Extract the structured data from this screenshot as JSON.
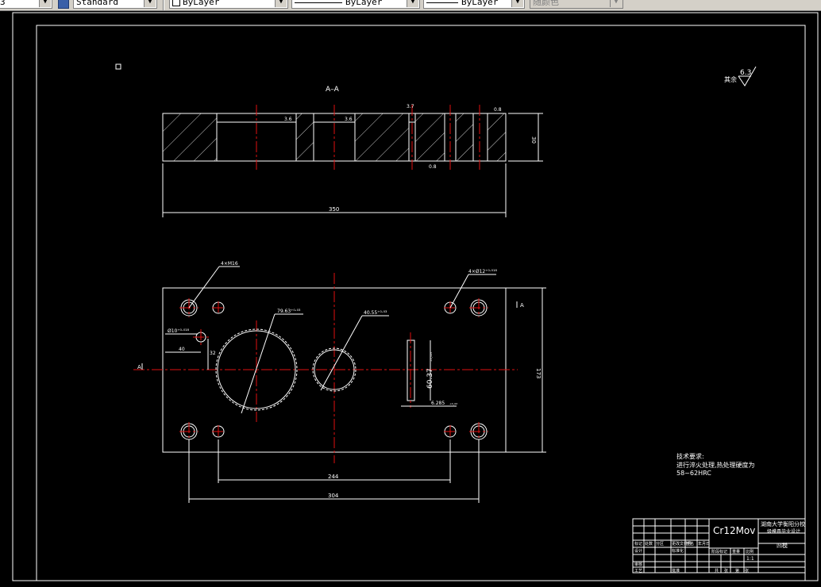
{
  "toolbar": {
    "left_stub": "3",
    "textstyle_value": "Standard",
    "layer_value": "ByLayer",
    "linetype_value": "ByLayer",
    "lineweight_value": "ByLayer",
    "color_value": "随颜色",
    "dropdown_arrow": "▼"
  },
  "drawing": {
    "section_label": "A–A",
    "roughness_prefix": "其余",
    "roughness_value": "6.3",
    "section_dims": {
      "total_width": "350",
      "height": "30",
      "label_1": "3.6",
      "label_2": "3.6",
      "label_3": "3.7",
      "label_4": "0.8",
      "label_5": "0.8"
    },
    "plan_dims": {
      "hole_4xm16": "4×M16",
      "hole_4xd12": "4×Ø12⁺⁰·⁰¹⁸",
      "dia_79": "79.63⁺⁰·⁰³",
      "dia_40": "40.55⁺⁰·⁰³",
      "dia_10": "Ø10⁺⁰·⁰¹⁸",
      "offset_40": "40",
      "offset_32": "32",
      "slot_length": "60.37",
      "slot_tol": "⁺⁰·⁰²⁵",
      "slot_width": "6.285",
      "slot_width_tol": "⁺⁰·⁰²",
      "height_173": "173",
      "pitch_244": "244",
      "pitch_304": "304",
      "section_mark_left": "A",
      "section_mark_right": "A"
    },
    "tech_req": {
      "title": "技术要求:",
      "line1": "进行淬火处理,热处理硬度为",
      "line2": "58~62HRC"
    },
    "title_block": {
      "material": "Cr12Mov",
      "school": "湖南大学衡阳分校",
      "project": "级模具毕业设计",
      "part_name": "凹模",
      "scale": "1:1",
      "labels": [
        "标记",
        "处数",
        "分区",
        "更改文件号",
        "签名",
        "年月日",
        "设计",
        "标准化",
        "阶段标记",
        "重量",
        "比例",
        "审核",
        "工艺",
        "批准",
        "共",
        "张",
        "第",
        "张"
      ]
    }
  }
}
